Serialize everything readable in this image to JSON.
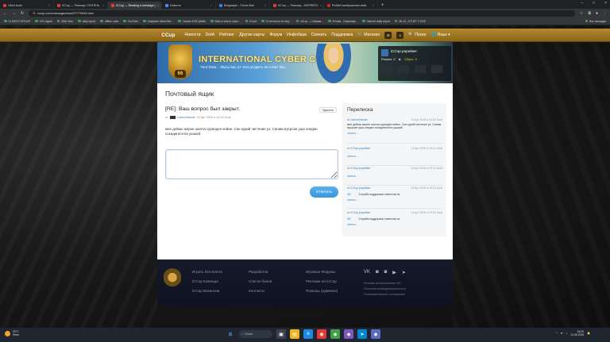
{
  "browser": {
    "tabs": [
      {
        "label": "Client book"
      },
      {
        "label": "iCCup — Помощь / ПОГЕНЬ"
      },
      {
        "label": "iCCup — Reading a message ("
      },
      {
        "label": "Новость"
      },
      {
        "label": "Входящие - Почта Mail"
      },
      {
        "label": "iCCup — Помощь - МОРФЕУС"
      },
      {
        "label": "PixMeil изображения abstr."
      }
    ],
    "url": "iccup.com/messages/read/27770944.html",
    "bookmarks": [
      "CLIENTS GROUP",
      "CRL Agent",
      "BSA Tech",
      "daily report",
      "offline rules",
      "YouTube",
      "Unsplash: Allow Ber...",
      "Yandex ЕЛЕ pbb8u",
      "Mail.ru почта, поис...",
      "E-hod",
      "Отчетность по пер...",
      "cl3 хр — Связыв...",
      "Enrolla - Симплиф...",
      "Internet daily report",
      "ML13 _ОТЧЕТ 2 ЕОЕ",
      "Все закладки"
    ]
  },
  "site": {
    "logo_prefix": "i",
    "logo_rest": "CCup",
    "nav": [
      "Новости",
      "DotA",
      "Рейтинг",
      "Другие карты",
      "Форум",
      "Инфобаза",
      "Скачать",
      "Поддержка",
      "Магазин"
    ],
    "search_label": "Поиск",
    "lang_label": "Язык"
  },
  "banner": {
    "title": "INTERNATIONAL CYBER CUP",
    "subtitle": "Your Dota... Фыгы вас от чего угодить но стоит Мы.",
    "level": "66"
  },
  "userpanel": {
    "name": "iCCup рорейкег",
    "rank_label": "Ранкен: 0",
    "coins_label": "Сброс: 0",
    "rating_label": "0",
    "mini": [
      "Ранн",
      "Сенгер",
      "Игры",
      "Рейтинг"
    ]
  },
  "mail": {
    "page_title": "Почтовый ящик",
    "subject": "[RE]: Ваш вопрос был закрыт.",
    "delete_label": "Удалить",
    "meta_prefix": "от",
    "author": "LamonNamat",
    "date": "13 Apr 2026 в 14:22 local",
    "body": "мне дейиш жерне шалча суранден кейин. Сан курий чигтенин уэ. Санам мусрсан уша онедан сохидигиголга ушшаб.",
    "reply_placeholder": "",
    "reply_label": "Ответить"
  },
  "conversation": {
    "title": "Переписка",
    "from_prefix": "от",
    "read_label": "читать...",
    "items": [
      {
        "from": "LamonNamat",
        "date": "13 Apr 2026 в 14:22 local",
        "text": "мне дейиш жерне шалча суранден кейин. Сан курий чигтенин уэ. Санам мусрсан уша онедан сохидигиголга ушшаб."
      },
      {
        "from": "iCCup рорейкег",
        "date": "13 Apr 2026 в 19:12 local",
        "text": ""
      },
      {
        "from": "iCCup рорейкег",
        "date": "13 Apr 2026 в 19:13 local",
        "text": ""
      },
      {
        "from": "iCCup рорейкег",
        "date": "13 Apr 2026 в 19:19 local",
        "sys_left": "ЧЕ",
        "sys_right": "Служба поддержки ответила на"
      },
      {
        "from": "iCCup рорейкег",
        "date": "13 Apr 2026 в 19:20 local",
        "sys_left": "ЧЕ",
        "sys_right": "Служба поддержки ответила на"
      }
    ]
  },
  "footer": {
    "col1": [
      "Играть бесплатно",
      "iCCup Команда",
      "iCCup Вакансии"
    ],
    "col2": [
      "Разработка",
      "Список банов",
      "Контакты"
    ],
    "col3": [
      "Игровые Форумы",
      "Реклама на iCCup",
      "Помощь (админка)"
    ],
    "socials": [
      "vk-icon",
      "discord-icon",
      "discord-icon",
      "youtube-icon",
      "telegram-icon"
    ],
    "legal": [
      "Условия использования 18+",
      "Политика конфиденциальности",
      "Пользовательское соглашение"
    ]
  },
  "taskbar": {
    "temp": "20°C",
    "weather": "Ясно",
    "search": "Поиск",
    "time": "16:20",
    "date": "13.05.2026"
  }
}
